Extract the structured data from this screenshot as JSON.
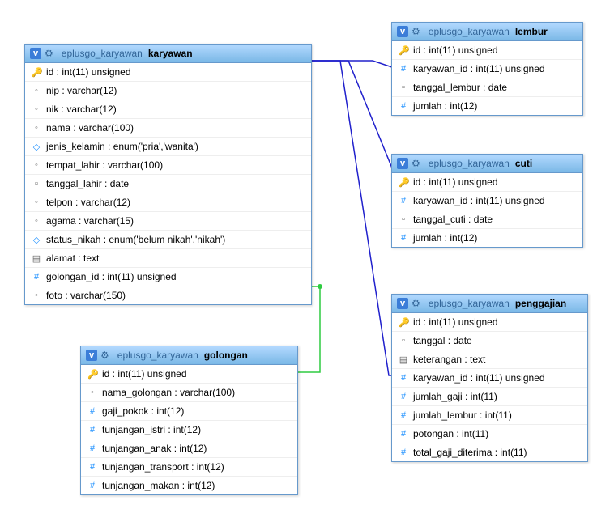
{
  "db": "eplusgo_karyawan",
  "tables": {
    "karyawan": {
      "name": "karyawan",
      "cols": [
        {
          "k": "key",
          "t": "id : int(11) unsigned"
        },
        {
          "k": "txt",
          "t": "nip : varchar(12)"
        },
        {
          "k": "txt",
          "t": "nik : varchar(12)"
        },
        {
          "k": "txt",
          "t": "nama : varchar(100)"
        },
        {
          "k": "dia",
          "t": "jenis_kelamin : enum('pria','wanita')"
        },
        {
          "k": "txt",
          "t": "tempat_lahir : varchar(100)"
        },
        {
          "k": "date",
          "t": "tanggal_lahir : date"
        },
        {
          "k": "txt",
          "t": "telpon : varchar(12)"
        },
        {
          "k": "txt",
          "t": "agama : varchar(15)"
        },
        {
          "k": "dia",
          "t": "status_nikah : enum('belum nikah','nikah')"
        },
        {
          "k": "txt2",
          "t": "alamat : text"
        },
        {
          "k": "hash",
          "t": "golongan_id : int(11) unsigned"
        },
        {
          "k": "txt",
          "t": "foto : varchar(150)"
        }
      ]
    },
    "golongan": {
      "name": "golongan",
      "cols": [
        {
          "k": "key",
          "t": "id : int(11) unsigned"
        },
        {
          "k": "txt",
          "t": "nama_golongan : varchar(100)"
        },
        {
          "k": "hash",
          "t": "gaji_pokok : int(12)"
        },
        {
          "k": "hash",
          "t": "tunjangan_istri : int(12)"
        },
        {
          "k": "hash",
          "t": "tunjangan_anak : int(12)"
        },
        {
          "k": "hash",
          "t": "tunjangan_transport : int(12)"
        },
        {
          "k": "hash",
          "t": "tunjangan_makan : int(12)"
        }
      ]
    },
    "lembur": {
      "name": "lembur",
      "cols": [
        {
          "k": "key",
          "t": "id : int(11) unsigned"
        },
        {
          "k": "hash",
          "t": "karyawan_id : int(11) unsigned"
        },
        {
          "k": "date",
          "t": "tanggal_lembur : date"
        },
        {
          "k": "hash",
          "t": "jumlah : int(12)"
        }
      ]
    },
    "cuti": {
      "name": "cuti",
      "cols": [
        {
          "k": "key",
          "t": "id : int(11) unsigned"
        },
        {
          "k": "hash",
          "t": "karyawan_id : int(11) unsigned"
        },
        {
          "k": "date",
          "t": "tanggal_cuti : date"
        },
        {
          "k": "hash",
          "t": "jumlah : int(12)"
        }
      ]
    },
    "penggajian": {
      "name": "penggajian",
      "cols": [
        {
          "k": "key",
          "t": "id : int(11) unsigned"
        },
        {
          "k": "date",
          "t": "tanggal : date"
        },
        {
          "k": "txt2",
          "t": "keterangan : text"
        },
        {
          "k": "hash",
          "t": "karyawan_id : int(11) unsigned"
        },
        {
          "k": "hash",
          "t": "jumlah_gaji : int(11)"
        },
        {
          "k": "hash",
          "t": "jumlah_lembur : int(11)"
        },
        {
          "k": "hash",
          "t": "potongan : int(11)"
        },
        {
          "k": "hash",
          "t": "total_gaji_diterima : int(11)"
        }
      ]
    }
  }
}
